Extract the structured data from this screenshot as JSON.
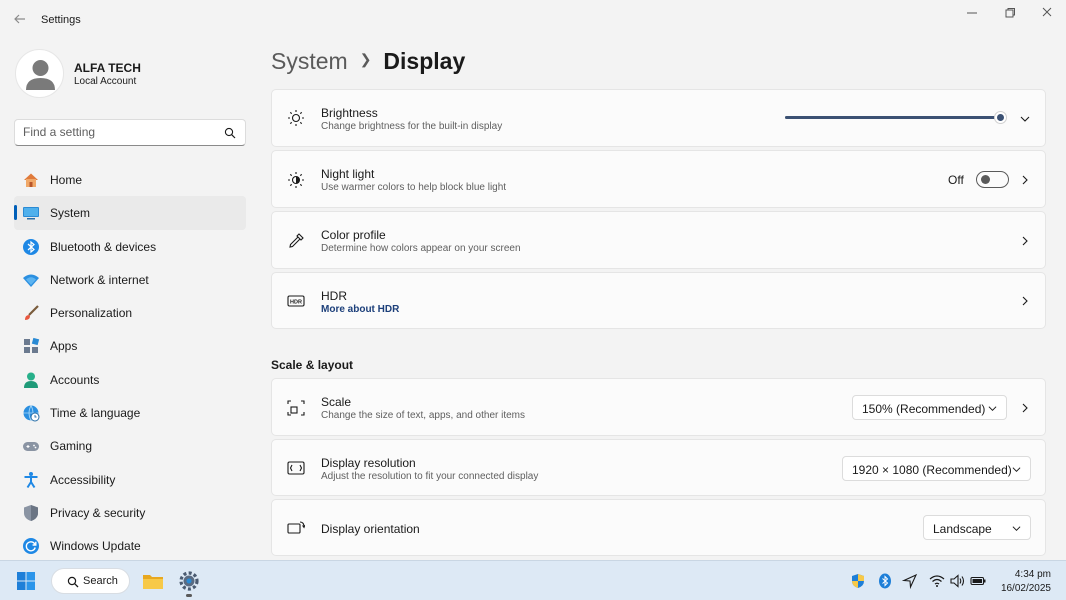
{
  "window": {
    "title": "Settings"
  },
  "profile": {
    "name": "ALFA TECH",
    "account_type": "Local Account"
  },
  "search": {
    "placeholder": "Find a setting"
  },
  "sidebar": {
    "active_index": 1,
    "items": [
      {
        "label": "Home",
        "icon": "home-icon"
      },
      {
        "label": "System",
        "icon": "system-monitor-icon"
      },
      {
        "label": "Bluetooth & devices",
        "icon": "bluetooth-icon"
      },
      {
        "label": "Network & internet",
        "icon": "wifi-icon"
      },
      {
        "label": "Personalization",
        "icon": "brush-icon"
      },
      {
        "label": "Apps",
        "icon": "apps-icon"
      },
      {
        "label": "Accounts",
        "icon": "person-icon"
      },
      {
        "label": "Time & language",
        "icon": "globe-clock-icon"
      },
      {
        "label": "Gaming",
        "icon": "gamepad-icon"
      },
      {
        "label": "Accessibility",
        "icon": "accessibility-icon"
      },
      {
        "label": "Privacy & security",
        "icon": "shield-icon"
      },
      {
        "label": "Windows Update",
        "icon": "update-icon"
      }
    ]
  },
  "breadcrumb": {
    "parent": "System",
    "current": "Display"
  },
  "cards": {
    "brightness": {
      "title": "Brightness",
      "subtitle": "Change brightness for the built-in display",
      "value_fraction": 1.0
    },
    "night_light": {
      "title": "Night light",
      "subtitle": "Use warmer colors to help block blue light",
      "state_label": "Off"
    },
    "color_profile": {
      "title": "Color profile",
      "subtitle": "Determine how colors appear on your screen"
    },
    "hdr": {
      "title": "HDR",
      "link": "More about HDR"
    }
  },
  "scale_layout": {
    "heading": "Scale & layout",
    "scale": {
      "title": "Scale",
      "subtitle": "Change the size of text, apps, and other items",
      "value": "150% (Recommended)"
    },
    "resolution": {
      "title": "Display resolution",
      "subtitle": "Adjust the resolution to fit your connected display",
      "value": "1920 × 1080 (Recommended)"
    },
    "orientation": {
      "title": "Display orientation",
      "value": "Landscape"
    }
  },
  "taskbar": {
    "search_label": "Search",
    "time": "4:34 pm",
    "date": "16/02/2025"
  },
  "colors": {
    "accent": "#005fb8",
    "slider": "#3b5173",
    "taskbar": "#dde9f5"
  }
}
